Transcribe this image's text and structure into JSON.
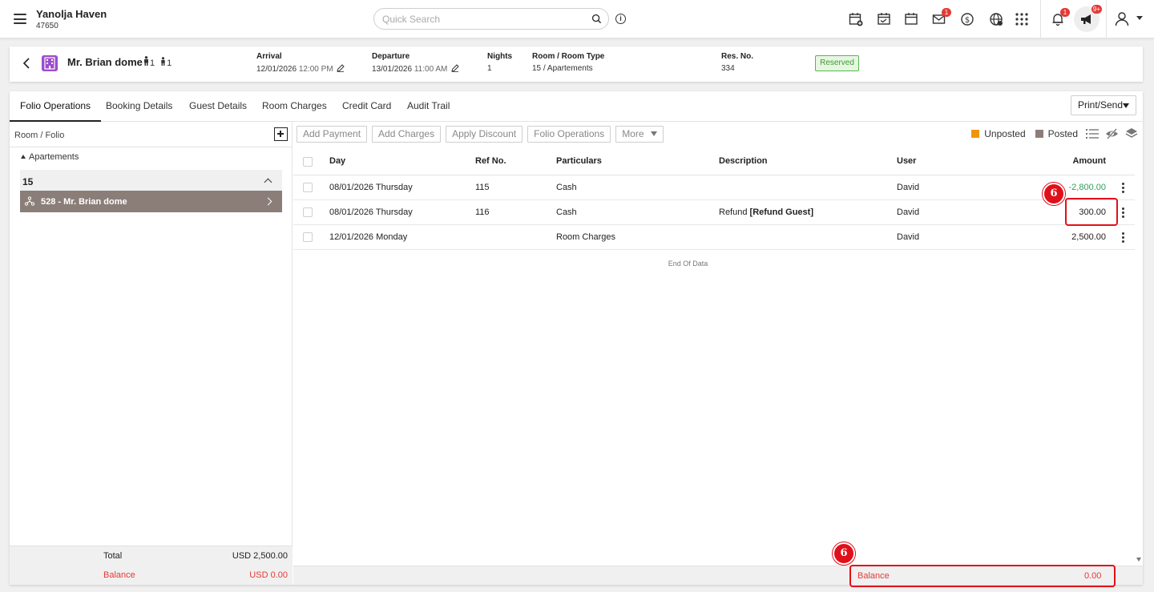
{
  "topbar": {
    "property_name": "Yanolja Haven",
    "property_code": "47650",
    "search_placeholder": "Quick Search",
    "notifications_badge": "1",
    "mail_badge": "1",
    "announcements_badge": "9+"
  },
  "guest": {
    "name": "Mr. Brian dome",
    "adults": "1",
    "children": "1",
    "arrival_label": "Arrival",
    "arrival_date": "12/01/2026",
    "arrival_time": "12:00 PM",
    "departure_label": "Departure",
    "departure_date": "13/01/2026",
    "departure_time": "11:00 AM",
    "nights_label": "Nights",
    "nights": "1",
    "room_label": "Room / Room Type",
    "room_value": "15 / Apartements",
    "res_label": "Res. No.",
    "res_no": "334",
    "status": "Reserved",
    "status_color": "#3d9c2f"
  },
  "tabs": [
    "Folio Operations",
    "Booking Details",
    "Guest Details",
    "Room Charges",
    "Credit Card",
    "Audit Trail"
  ],
  "print_send_label": "Print/Send",
  "left_pane": {
    "header": "Room / Folio",
    "group": "Apartements",
    "room": "15",
    "folio_item": "528 - Mr. Brian dome",
    "total_label": "Total",
    "total_value": "USD 2,500.00",
    "balance_label": "Balance",
    "balance_value": "USD 0.00"
  },
  "toolbar": {
    "add_payment": "Add Payment",
    "add_charges": "Add Charges",
    "apply_discount": "Apply Discount",
    "folio_operations": "Folio Operations",
    "more": "More"
  },
  "legend": {
    "unposted": "Unposted",
    "unposted_color": "#f0950a",
    "posted": "Posted",
    "posted_color": "#8b7e78"
  },
  "table": {
    "headers": {
      "day": "Day",
      "ref": "Ref No.",
      "particulars": "Particulars",
      "description": "Description",
      "user": "User",
      "amount": "Amount"
    },
    "rows": [
      {
        "day": "08/01/2026 Thursday",
        "ref": "115",
        "particulars": "Cash",
        "description": "",
        "description_bold": "",
        "user": "David",
        "amount": "-2,800.00"
      },
      {
        "day": "08/01/2026 Thursday",
        "ref": "116",
        "particulars": "Cash",
        "description": "Refund",
        "description_bold": "[Refund Guest]",
        "user": "David",
        "amount": "300.00"
      },
      {
        "day": "12/01/2026 Monday",
        "ref": "",
        "particulars": "Room Charges",
        "description": "",
        "description_bold": "",
        "user": "David",
        "amount": "2,500.00"
      }
    ],
    "end_of_data": "End Of Data"
  },
  "footer": {
    "balance_label": "Balance",
    "balance_value": "0.00"
  },
  "annotations": {
    "marker_label": "6",
    "color": "#e0101a"
  }
}
